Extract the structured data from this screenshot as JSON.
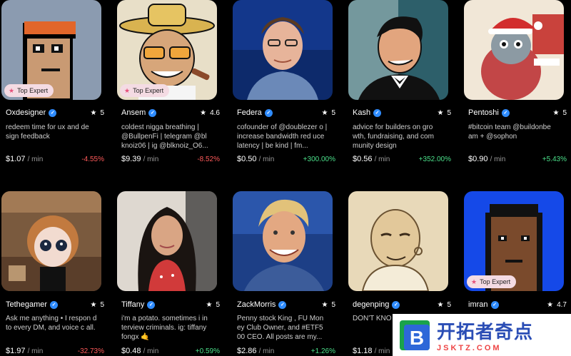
{
  "badge_label": "Top Expert",
  "per_min": "/ min",
  "cards": [
    {
      "name": "Oxdesigner",
      "rating": "5",
      "bio": "redeem time for ux and de sign feedback",
      "price": "$1.07",
      "change": "-4.55%",
      "positive": false,
      "badge": true
    },
    {
      "name": "Ansem",
      "rating": "4.6",
      "bio": "coldest nigga breathing | @BullpenFi | telegram @bl knoiz06 | ig @blknoiz_O6...",
      "price": "$9.39",
      "change": "-8.52%",
      "positive": false,
      "badge": true
    },
    {
      "name": "Federa",
      "rating": "5",
      "bio": "cofounder of @doublezer o | increase bandwidth red uce latency | be kind | fm...",
      "price": "$0.50",
      "change": "+300.00%",
      "positive": true,
      "badge": false
    },
    {
      "name": "Kash",
      "rating": "5",
      "bio": "advice for builders on gro wth, fundraising, and com munity design",
      "price": "$0.56",
      "change": "+352.00%",
      "positive": true,
      "badge": false
    },
    {
      "name": "Pentoshi",
      "rating": "5",
      "bio": "#bitcoin team @buildonbe am + @sophon",
      "price": "$0.90",
      "change": "+5.43%",
      "positive": true,
      "badge": false
    },
    {
      "name": "Tethegamer",
      "rating": "5",
      "bio": "Ask me anything • I respon d to every DM, and voice c all.",
      "price": "$1.97",
      "change": "-32.73%",
      "positive": false,
      "badge": false
    },
    {
      "name": "Tiffany",
      "rating": "5",
      "bio": "i'm a potato. sometimes i in terview criminals. ig: tiffany fongx 🤙",
      "price": "$0.48",
      "change": "+0.59%",
      "positive": true,
      "badge": false
    },
    {
      "name": "ZackMorris",
      "rating": "5",
      "bio": "Penny stock King , FU Mon ey Club Owner, and #ETF5 00 CEO. All posts are my...",
      "price": "$2.86",
      "change": "+1.26%",
      "positive": true,
      "badge": false
    },
    {
      "name": "degenping",
      "rating": "5",
      "bio": "DON'T KNO",
      "price": "$1.18",
      "change": "",
      "positive": true,
      "badge": false
    },
    {
      "name": "imran",
      "rating": "4.7",
      "bio": "",
      "price": "",
      "change": "",
      "positive": true,
      "badge": true
    }
  ],
  "watermark": {
    "title": "开拓者奇点",
    "url": "JSKTZ.COM",
    "logo_letter": "B"
  }
}
